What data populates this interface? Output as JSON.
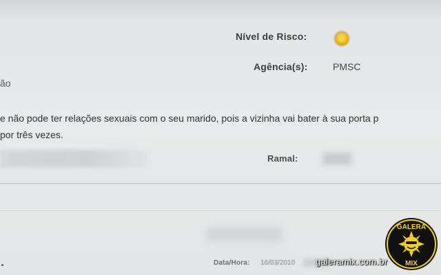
{
  "form": {
    "risk_label": "Nível de Risco:",
    "risk_indicator_color": "#f5c21a",
    "agency_label": "Agência(s):",
    "agency_value": "PMSC",
    "fragment": "ão",
    "message_line1": "e não pode ter relações sexuais com o seu marido, pois a vizinha vai bater à sua porta p",
    "message_line2": "por três vezes.",
    "ramal_label": "Ramal:",
    "datetime_label": "Data/Hora:",
    "datetime_value": "16/03/2010"
  },
  "watermark": {
    "site": "galeramix.com.br",
    "logo_top": "GALERA",
    "logo_bottom": "MIX"
  }
}
